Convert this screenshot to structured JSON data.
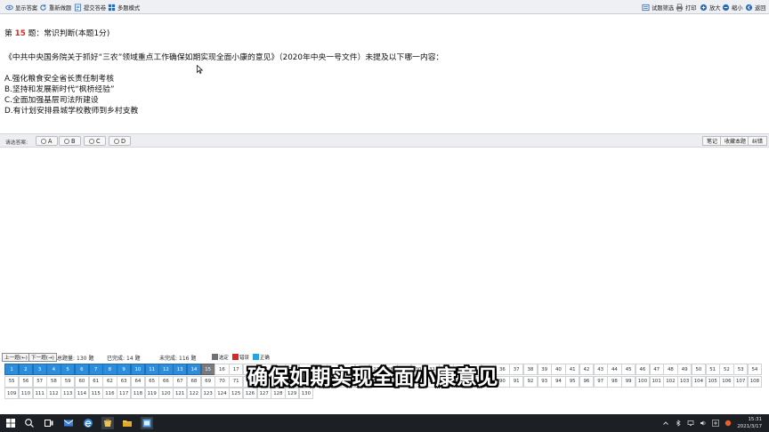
{
  "toolbar": {
    "left": [
      {
        "label": "显示答案",
        "icon": "eye-icon"
      },
      {
        "label": "重新做题",
        "icon": "refresh-icon"
      },
      {
        "label": "提交答卷",
        "icon": "submit-icon"
      },
      {
        "label": "多题模式",
        "icon": "multi-mode-icon"
      }
    ],
    "right": [
      {
        "label": "试题筛选",
        "icon": "filter-icon"
      },
      {
        "label": "打印",
        "icon": "print-icon"
      },
      {
        "label": "放大",
        "icon": "zoom-in-icon"
      },
      {
        "label": "缩小",
        "icon": "zoom-out-icon"
      },
      {
        "label": "返回",
        "icon": "back-icon"
      }
    ]
  },
  "question": {
    "prefix": "第 ",
    "number": "15",
    "suffix": " 题：常识判断(本题1分)",
    "stem": "《中共中央国务院关于抓好“三农”领域重点工作确保如期实现全面小康的意见》（2020年中央一号文件）未提及以下哪一内容：",
    "options": [
      "A.强化粮食安全省长责任制考核",
      "B.坚持和发展新时代“枫桥经验”",
      "C.全面加强基层司法所建设",
      "D.有计划安排县城学校教师到乡村支教"
    ]
  },
  "answer_bar": {
    "label": "请选答案:",
    "choices": [
      "A",
      "B",
      "C",
      "D"
    ],
    "buttons": [
      "笔记",
      "收藏本题",
      "纠错"
    ]
  },
  "status": {
    "prev": "上一题(←)",
    "next": "下一题(→)",
    "total_label": "总题量:",
    "total": "130",
    "done_label": "已完成:",
    "done": "14",
    "undone_label": "未完成:",
    "undone": "116",
    "unit": "题",
    "legend": [
      {
        "label": "选定",
        "color": "#6d7075"
      },
      {
        "label": "错误",
        "color": "#d9262b"
      },
      {
        "label": "正确",
        "color": "#23a6e0"
      }
    ]
  },
  "grid": {
    "total": 130,
    "per_row": 54,
    "completed_count": 14,
    "current": 15,
    "done_color": "#2a8ddd",
    "current_color": "#777a7e"
  },
  "subtitle": "确保如期实现全面小康意见",
  "taskbar": {
    "time": "15:31",
    "date": "2021/3/17"
  }
}
